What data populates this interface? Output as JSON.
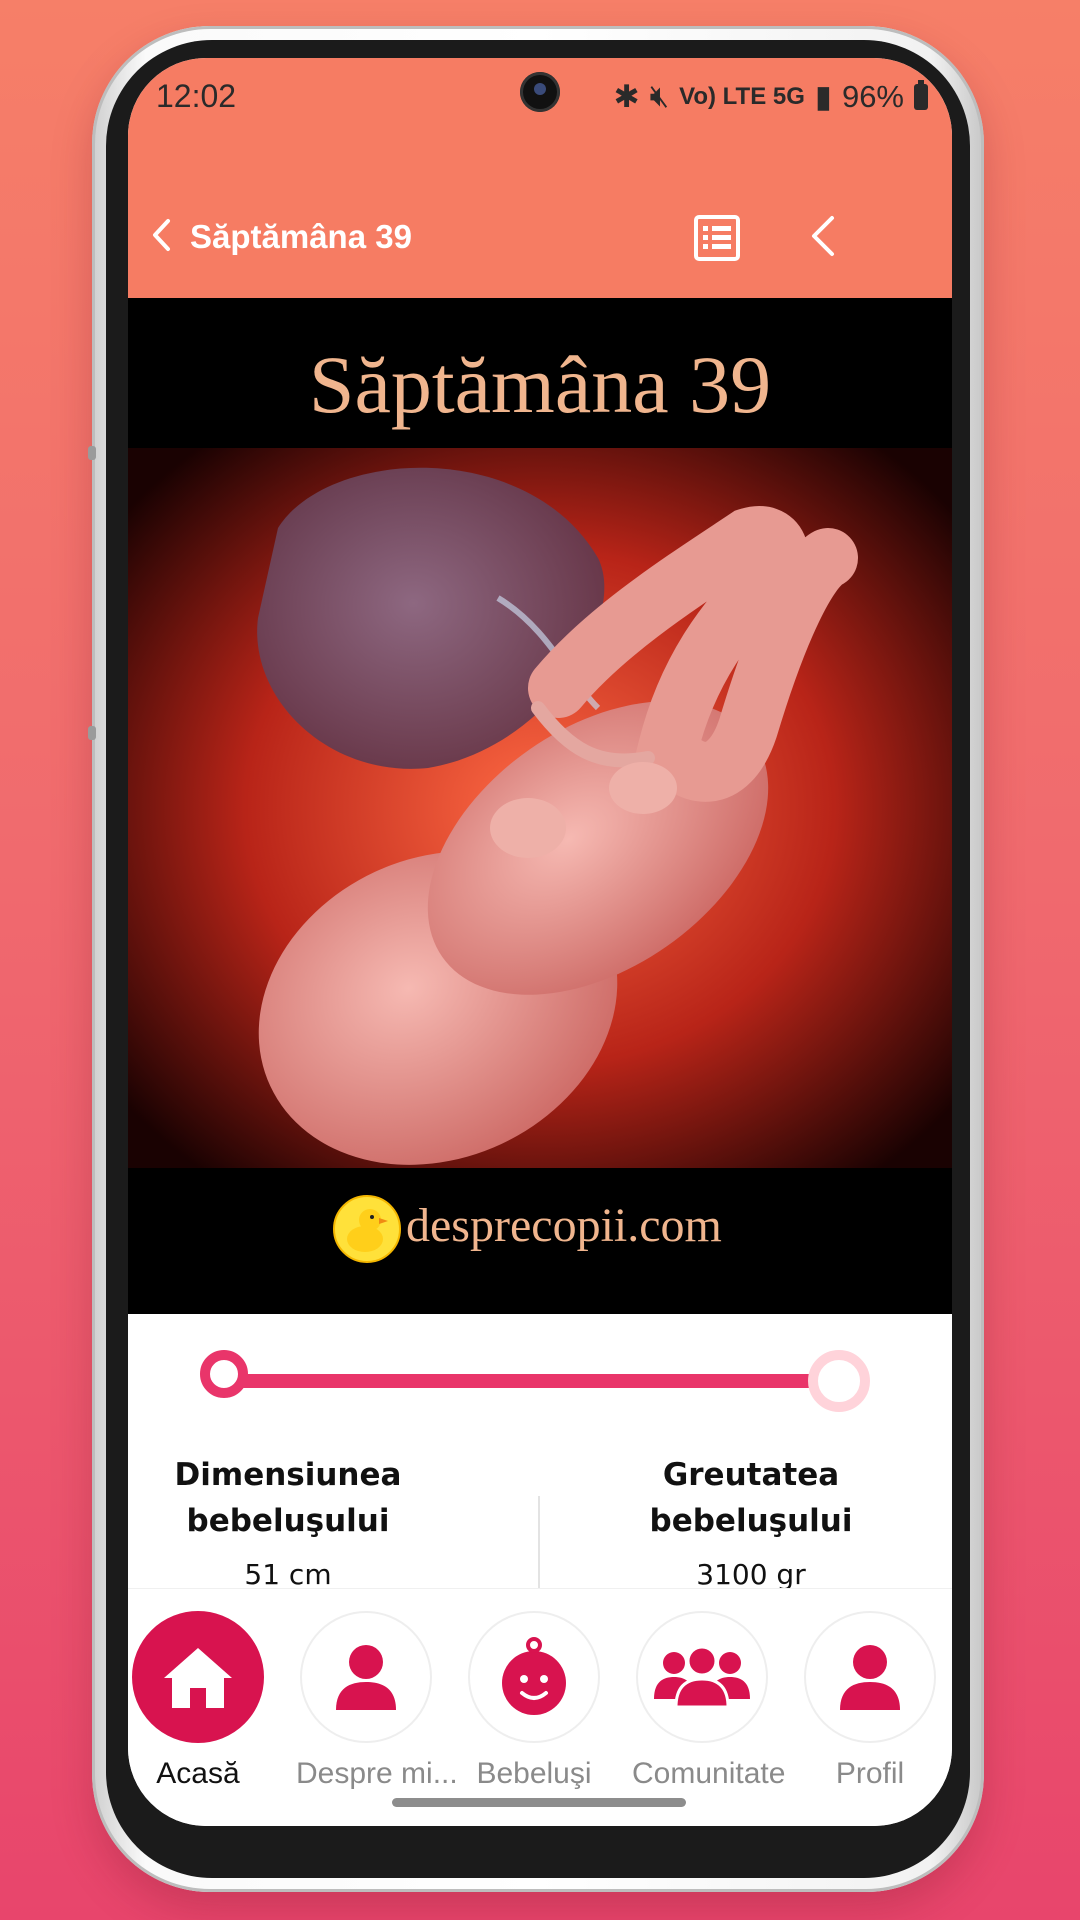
{
  "status_bar": {
    "time": "12:02",
    "network_icons": "Vo) LTE 5G",
    "battery": "96%"
  },
  "app_bar": {
    "title": "Săptămâna 39",
    "icons": [
      "back-icon",
      "list-icon",
      "previous-icon"
    ]
  },
  "hero": {
    "title": "Săptămâna 39",
    "brand": "desprecopii.com"
  },
  "progress": {
    "fraction": 0.96
  },
  "stats": {
    "size": {
      "label_line1": "Dimensiunea",
      "label_line2": "bebeluşului",
      "value": "51 cm"
    },
    "weight": {
      "label_line1": "Greutatea",
      "label_line2": "bebeluşului",
      "value": "3100 gr"
    }
  },
  "bottom_nav": {
    "items": [
      {
        "label": "Acasă",
        "icon": "home-icon",
        "active": true
      },
      {
        "label": "Despre mi...",
        "icon": "person-icon",
        "active": false
      },
      {
        "label": "Bebeluşi",
        "icon": "baby-face-icon",
        "active": false
      },
      {
        "label": "Comunitate",
        "icon": "group-icon",
        "active": false
      },
      {
        "label": "Profil",
        "icon": "profile-icon",
        "active": false
      }
    ]
  },
  "colors": {
    "app_bar": "#f67c63",
    "accent": "#d8134f",
    "progress": "#e9356a",
    "hero_text": "#f0b58e"
  }
}
